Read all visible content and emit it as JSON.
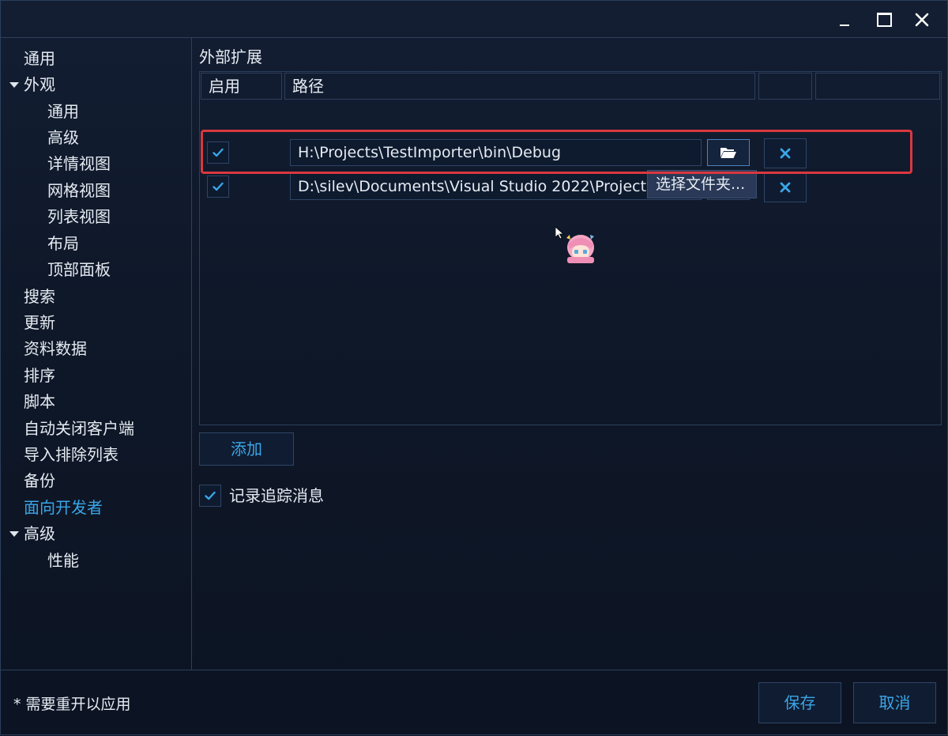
{
  "window": {
    "controls": {
      "minimize": "minimize-icon",
      "maximize": "maximize-icon",
      "close": "close-icon"
    }
  },
  "sidebar": {
    "items": [
      {
        "label": "通用",
        "level": 0
      },
      {
        "label": "外观",
        "level": 0,
        "expanded": true
      },
      {
        "label": "通用",
        "level": 1
      },
      {
        "label": "高级",
        "level": 1
      },
      {
        "label": "详情视图",
        "level": 1
      },
      {
        "label": "网格视图",
        "level": 1
      },
      {
        "label": "列表视图",
        "level": 1
      },
      {
        "label": "布局",
        "level": 1
      },
      {
        "label": "顶部面板",
        "level": 1
      },
      {
        "label": "搜索",
        "level": 0
      },
      {
        "label": "更新",
        "level": 0
      },
      {
        "label": "资料数据",
        "level": 0
      },
      {
        "label": "排序",
        "level": 0
      },
      {
        "label": "脚本",
        "level": 0
      },
      {
        "label": "自动关闭客户端",
        "level": 0
      },
      {
        "label": "导入排除列表",
        "level": 0
      },
      {
        "label": "备份",
        "level": 0
      },
      {
        "label": "面向开发者",
        "level": 0,
        "active": true
      },
      {
        "label": "高级",
        "level": 0,
        "expanded": true
      },
      {
        "label": "性能",
        "level": 1
      }
    ]
  },
  "main": {
    "section_title": "外部扩展",
    "table": {
      "columns": [
        "启用",
        "路径",
        "",
        ""
      ],
      "rows": [
        {
          "enabled": true,
          "path": "H:\\Projects\\TestImporter\\bin\\Debug"
        },
        {
          "enabled": true,
          "path": "D:\\silev\\Documents\\Visual Studio 2022\\Projects"
        }
      ]
    },
    "tooltip": "选择文件夹...",
    "add_label": "添加",
    "trace": {
      "checked": true,
      "label": "记录追踪消息"
    }
  },
  "footer": {
    "note": "* 需要重开以应用",
    "save_label": "保存",
    "cancel_label": "取消"
  },
  "colors": {
    "background": "#0d1526",
    "accent": "#3aa6e8",
    "border": "#2c3f5c",
    "highlight": "#d9383f"
  }
}
